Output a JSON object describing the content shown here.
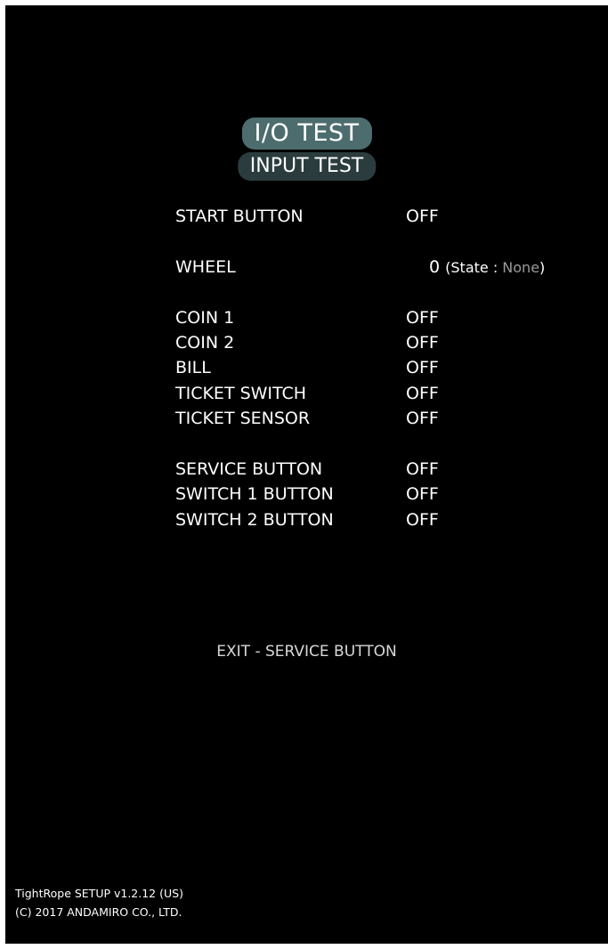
{
  "header": {
    "title": "I/O TEST",
    "subtitle": "INPUT TEST"
  },
  "inputs": {
    "start_button": {
      "label": "START BUTTON",
      "value": "OFF"
    },
    "wheel": {
      "label": "WHEEL",
      "value": "0",
      "state_prefix": "(State : ",
      "state_value": "None",
      "state_suffix": ")"
    },
    "coin_1": {
      "label": "COIN 1",
      "value": "OFF"
    },
    "coin_2": {
      "label": "COIN 2",
      "value": "OFF"
    },
    "bill": {
      "label": "BILL",
      "value": "OFF"
    },
    "ticket_switch": {
      "label": "TICKET SWITCH",
      "value": "OFF"
    },
    "ticket_sensor": {
      "label": "TICKET SENSOR",
      "value": "OFF"
    },
    "service_button": {
      "label": "SERVICE BUTTON",
      "value": "OFF"
    },
    "switch_1_button": {
      "label": "SWITCH 1 BUTTON",
      "value": "OFF"
    },
    "switch_2_button": {
      "label": "SWITCH 2 BUTTON",
      "value": "OFF"
    }
  },
  "exit_hint": "EXIT - SERVICE BUTTON",
  "footer": {
    "version": "TightRope SETUP v1.2.12 (US)",
    "copyright": "(C) 2017 ANDAMIRO CO., LTD."
  },
  "colors": {
    "background": "#000000",
    "title_pill": "#4d6c6e",
    "subtitle_pill": "#2b3c3e",
    "text": "#ffffff",
    "state_value": "#9a9a9a"
  }
}
